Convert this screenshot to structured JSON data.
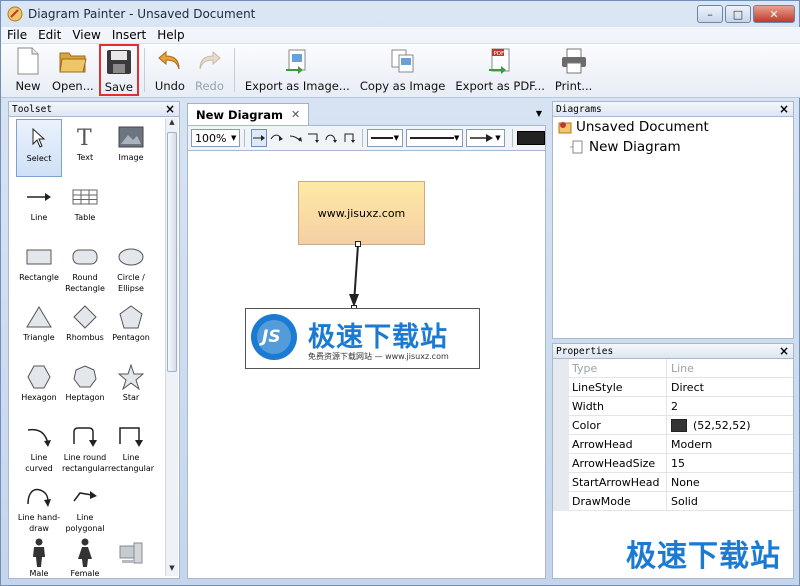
{
  "window": {
    "title": "Diagram Painter - Unsaved Document",
    "minimize": "–",
    "maximize": "□",
    "close": "✕"
  },
  "menu": [
    "File",
    "Edit",
    "View",
    "Insert",
    "Help"
  ],
  "toolbar": [
    {
      "label": "New",
      "icon": "new-document-icon",
      "state": "normal"
    },
    {
      "label": "Open...",
      "icon": "folder-open-icon",
      "state": "normal"
    },
    {
      "label": "Save",
      "icon": "floppy-disk-icon",
      "state": "highlighted"
    },
    {
      "label": "Undo",
      "icon": "undo-icon",
      "state": "normal"
    },
    {
      "label": "Redo",
      "icon": "redo-icon",
      "state": "disabled"
    },
    {
      "label": "Export as Image...",
      "icon": "export-image-icon",
      "state": "normal"
    },
    {
      "label": "Copy as Image",
      "icon": "copy-image-icon",
      "state": "normal"
    },
    {
      "label": "Export as PDF...",
      "icon": "export-pdf-icon",
      "state": "normal"
    },
    {
      "label": "Print...",
      "icon": "printer-icon",
      "state": "normal"
    }
  ],
  "toolset": {
    "title": "Toolset",
    "items": [
      {
        "label": "Select",
        "icon": "cursor-arrow-icon",
        "selected": true
      },
      {
        "label": "Text",
        "icon": "text-t-icon"
      },
      {
        "label": "Image",
        "icon": "image-icon"
      },
      {
        "label": "Line",
        "icon": "line-arrow-icon"
      },
      {
        "label": "Table",
        "icon": "table-icon"
      },
      {
        "label": "",
        "icon": ""
      },
      {
        "label": "Rectangle",
        "icon": "rectangle-icon"
      },
      {
        "label": "Round Rectangle",
        "icon": "round-rectangle-icon"
      },
      {
        "label": "Circle / Ellipse",
        "icon": "ellipse-icon"
      },
      {
        "label": "Triangle",
        "icon": "triangle-icon"
      },
      {
        "label": "Rhombus",
        "icon": "rhombus-icon"
      },
      {
        "label": "Pentagon",
        "icon": "pentagon-icon"
      },
      {
        "label": "Hexagon",
        "icon": "hexagon-icon"
      },
      {
        "label": "Heptagon",
        "icon": "heptagon-icon"
      },
      {
        "label": "Star",
        "icon": "star-icon"
      },
      {
        "label": "Line curved",
        "icon": "line-curved-icon"
      },
      {
        "label": "Line round rectangular",
        "icon": "line-round-rect-icon"
      },
      {
        "label": "Line rectangular",
        "icon": "line-rect-icon"
      },
      {
        "label": "Line hand-draw",
        "icon": "line-handdraw-icon"
      },
      {
        "label": "Line polygonal",
        "icon": "line-polygonal-icon"
      },
      {
        "label": "",
        "icon": ""
      },
      {
        "label": "Male",
        "icon": "male-figure-icon"
      },
      {
        "label": "Female",
        "icon": "female-figure-icon"
      },
      {
        "label": "",
        "icon": "computer-icon"
      }
    ]
  },
  "document": {
    "tab": "New Diagram",
    "zoom": "100%",
    "box_text": "www.jisuxz.com",
    "logo_big": "极速下载站",
    "logo_small": "免费资源下载网站 — www.jisuxz.com",
    "logo_badge": "JS"
  },
  "diagrams": {
    "title": "Diagrams",
    "root": "Unsaved Document",
    "child": "New Diagram"
  },
  "properties": {
    "title": "Properties",
    "header": {
      "key": "Type",
      "value": "Line"
    },
    "rows": [
      {
        "key": "LineStyle",
        "value": "Direct"
      },
      {
        "key": "Width",
        "value": "2"
      },
      {
        "key": "Color",
        "value": "(52,52,52)",
        "swatch": "#343434"
      },
      {
        "key": "ArrowHead",
        "value": "Modern"
      },
      {
        "key": "ArrowHeadSize",
        "value": "15"
      },
      {
        "key": "StartArrowHead",
        "value": "None"
      },
      {
        "key": "DrawMode",
        "value": "Solid"
      }
    ]
  },
  "watermark": "极速下载站",
  "colors": {
    "accent": "#1b7ad1",
    "highlight_border": "#e03030",
    "box_fill_top": "#fdeaa3",
    "box_fill_bottom": "#f6cfa5"
  }
}
